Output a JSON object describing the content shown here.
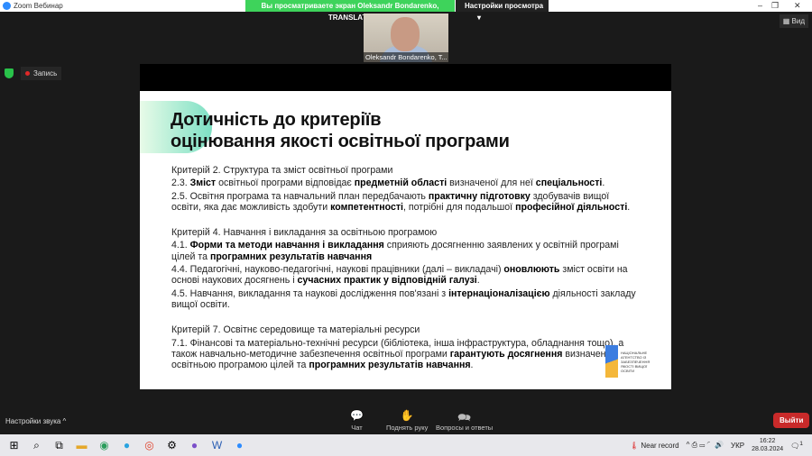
{
  "window": {
    "title": "Zoom Вебинар",
    "banner": "Вы просматриваете экран Oleksandr Bondarenko, TRANSLAT...",
    "view_settings": "Настройки просмотра",
    "view_button": "Вид",
    "record": "Запись"
  },
  "video": {
    "name": "Oleksandr Bondarenko, T..."
  },
  "slide": {
    "title_line1": "Дотичність до критеріїв",
    "title_line2": "оцінювання якості освітньої програми",
    "paragraphs": [
      [
        [
          "Критерій 2. Структура та зміст освітньої програми",
          0
        ]
      ],
      [
        [
          "2.3. ",
          0
        ],
        [
          "Зміст",
          1
        ],
        [
          " освітньої програми відповідає ",
          0
        ],
        [
          "предметній області",
          1
        ],
        [
          " визначеної для неї ",
          0
        ],
        [
          "спеціальності",
          1
        ],
        [
          ".",
          0
        ]
      ],
      [
        [
          "2.5. Освітня програма та навчальний план передбачають ",
          0
        ],
        [
          "практичну підготовку",
          1
        ],
        [
          " здобувачів вищої освіти, яка дає можливість здобути ",
          0
        ],
        [
          "компетентності",
          1
        ],
        [
          ", потрібні для подальшої ",
          0
        ],
        [
          "професійної діяльності",
          1
        ],
        [
          ".",
          0
        ]
      ],
      "gap",
      [
        [
          "Критерій 4. Навчання і викладання за освітньою програмою",
          0
        ]
      ],
      [
        [
          "4.1. ",
          0
        ],
        [
          "Форми та методи навчання і викладання",
          1
        ],
        [
          " сприяють досягненню заявлених у освітній програмі цілей та ",
          0
        ],
        [
          "програмних результатів навчання",
          1
        ]
      ],
      [
        [
          "4.4. Педагогічні, науково-педагогічні, наукові працівники (далі – викладачі) ",
          0
        ],
        [
          "оновлюють",
          1
        ],
        [
          " зміст освіти на основі наукових досягнень і ",
          0
        ],
        [
          "сучасних практик у відповідній галузі",
          1
        ],
        [
          ".",
          0
        ]
      ],
      [
        [
          "4.5. Навчання, викладання та наукові дослідження пов'язані з ",
          0
        ],
        [
          "інтернаціоналізацією",
          1
        ],
        [
          " діяльності закладу вищої освіти.",
          0
        ]
      ],
      "gap",
      [
        [
          "Критерій 7. Освітнє середовище та матеріальні ресурси",
          0
        ]
      ],
      [
        [
          "7.1. Фінансові та матеріально-технічні ресурси (бібліотека, інша інфраструктура, обладнання тощо), а також навчально-методичне забезпечення освітньої програми ",
          0
        ],
        [
          "гарантують досягнення",
          1
        ],
        [
          " визначених освітньою програмою цілей та ",
          0
        ],
        [
          "програмних результатів навчання",
          1
        ],
        [
          ".",
          0
        ]
      ]
    ],
    "logo_text": "НАЦІОНАЛЬНЕ АГЕНТСТВО ІЗ ЗАБЕЗПЕЧЕННЯ ЯКОСТІ ВИЩОЇ ОСВІТИ"
  },
  "controls": {
    "audio": "Настройки звука ^",
    "chat": "Чат",
    "raise_hand": "Поднять руку",
    "qa": "Вопросы и ответы",
    "exit": "Выйти"
  },
  "tray": {
    "weather": "Near record",
    "lang": "УКР",
    "time": "16:22",
    "date": "28.03.2024",
    "notif": "1"
  }
}
